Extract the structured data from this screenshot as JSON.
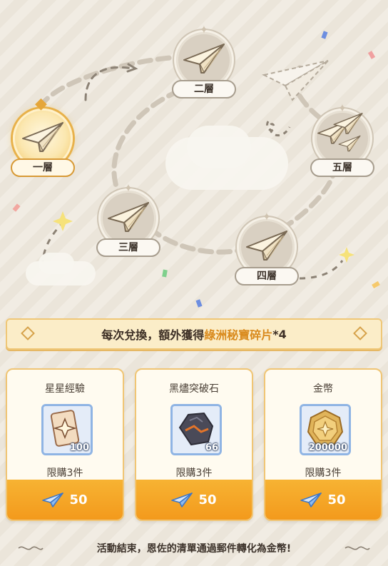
{
  "map": {
    "floors": [
      {
        "label": "一層",
        "state": "current"
      },
      {
        "label": "二層",
        "state": "locked"
      },
      {
        "label": "三層",
        "state": "locked"
      },
      {
        "label": "四層",
        "state": "locked"
      },
      {
        "label": "五層",
        "state": "locked"
      }
    ]
  },
  "banner": {
    "text_prefix": "每次兌換，額外獲得",
    "highlight": "綠洲秘寶碎片",
    "suffix": "*4",
    "highlight_color": "#d98a1d"
  },
  "shop": {
    "items": [
      {
        "name": "星星經驗",
        "qty": "100",
        "limit": "限購3件",
        "price": "50",
        "icon": "star-exp-card-icon"
      },
      {
        "name": "黑燼突破石",
        "qty": "66",
        "limit": "限購3件",
        "price": "50",
        "icon": "black-ember-stone-icon"
      },
      {
        "name": "金幣",
        "qty": "200000",
        "limit": "限購3件",
        "price": "50",
        "icon": "gold-coin-icon"
      }
    ],
    "currency_icon": "paper-plane-icon",
    "button_color": "#f5a623"
  },
  "footer": {
    "text": "活動結束，恩佐的清單通過郵件轉化為金幣!"
  }
}
